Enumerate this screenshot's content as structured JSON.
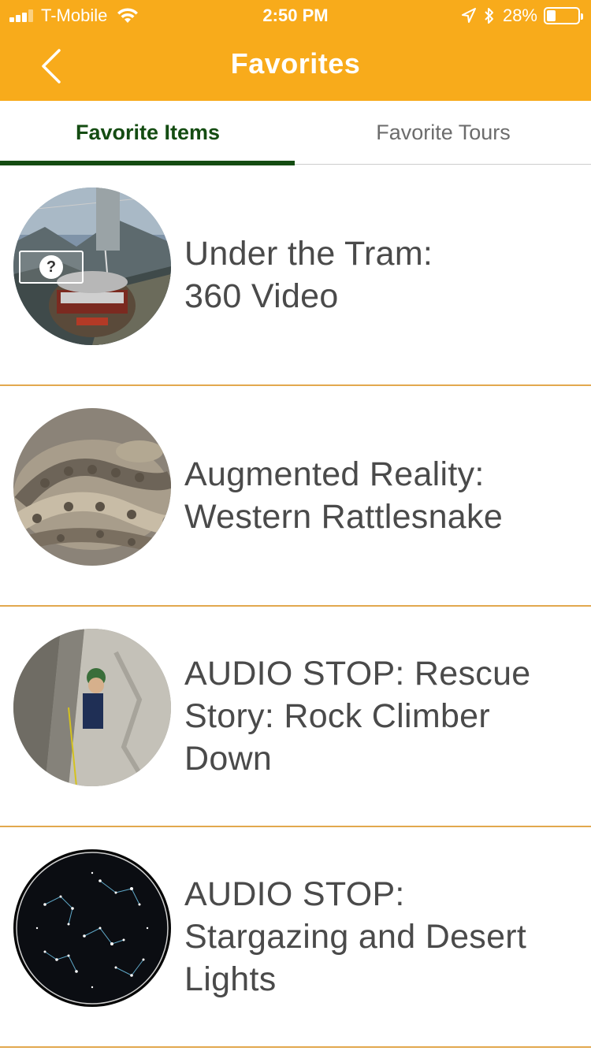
{
  "status_bar": {
    "carrier": "T-Mobile",
    "time": "2:50 PM",
    "battery": "28%",
    "battery_level": 0.28
  },
  "nav": {
    "title": "Favorites",
    "back_icon": "chevron-left-icon"
  },
  "tabs": [
    {
      "label": "Favorite Items",
      "active": true
    },
    {
      "label": "Favorite Tours",
      "active": false
    }
  ],
  "items": [
    {
      "title_lines": [
        "Under the Tram:",
        "360 Video"
      ],
      "thumb": "aerial-tramway-photo"
    },
    {
      "title_lines": [
        "Augmented Reality:",
        "Western Rattlesnake"
      ],
      "thumb": "rattlesnake-photo"
    },
    {
      "title_lines": [
        "AUDIO STOP: Rescue",
        "Story: Rock Climber",
        "Down"
      ],
      "thumb": "rock-climber-photo"
    },
    {
      "title_lines": [
        "AUDIO STOP:",
        "Stargazing and Desert",
        "Lights"
      ],
      "thumb": "star-chart-photo"
    }
  ],
  "colors": {
    "header": "#f8ab1b",
    "tab_active": "#144c12",
    "divider": "#e2a84e",
    "title_text": "#4a4a4a"
  }
}
